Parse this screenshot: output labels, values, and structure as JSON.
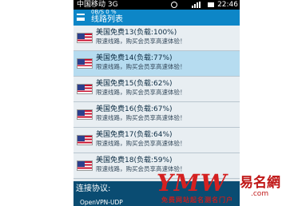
{
  "status_bar": {
    "carrier": "中国移动 3G",
    "time": "22:46"
  },
  "app_bar": {
    "indicator": "0B/S  0  %",
    "title": "线路列表"
  },
  "servers": [
    {
      "name": "美国免费13(负载:100%)",
      "desc": "限速线路，购买会员享高速体验！",
      "selected": false
    },
    {
      "name": "美国免费14(负载:77%)",
      "desc": "限速线路，购买会员享高速体验！",
      "selected": true
    },
    {
      "name": "美国免费15(负载:62%)",
      "desc": "限速线路，购买会员享高速体验！",
      "selected": false
    },
    {
      "name": "美国免费16(负载:67%)",
      "desc": "限速线路，购买会员享高速体验！",
      "selected": false
    },
    {
      "name": "美国免费17(负载:64%)",
      "desc": "限速线路，购买会员享高速体验！",
      "selected": false
    },
    {
      "name": "美国免费18(负载:59%)",
      "desc": "限速线路，购买会员享高速体验！",
      "selected": false
    }
  ],
  "protocol": {
    "label": "连接协议:",
    "option": "OpenVPN-UDP"
  },
  "watermark": {
    "logo": "YMW",
    "brand": "易名網",
    "slogan": "免费网站起名测名门户",
    "domain": ".com"
  },
  "colors": {
    "accent": "#0d86c7",
    "selected_row": "#b6dcf0",
    "protocol_bg": "#0a4c72",
    "watermark": "#d42020"
  }
}
